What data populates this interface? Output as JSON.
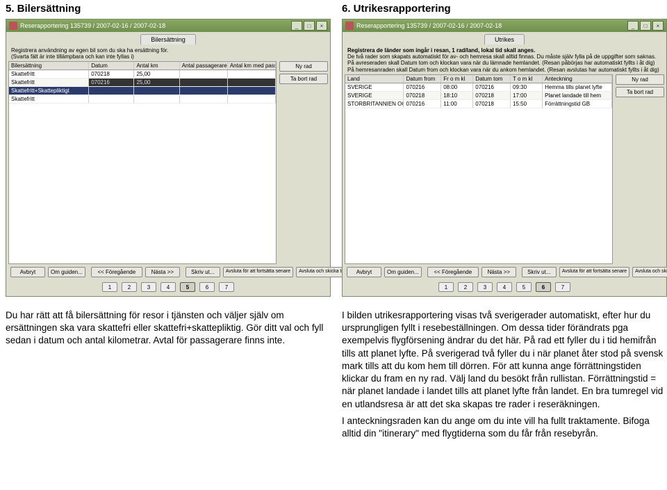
{
  "left": {
    "section_title": "5. Bilersättning",
    "window_title": "Reserapportering 135739 / 2007-02-16 / 2007-02-18",
    "tab_label": "Bilersättning",
    "instructions": [
      "Registrera användning av egen bil som du ska ha ersättning för.",
      "(Svarta fält är inte tillämpbara och kan inte fyllas i)"
    ],
    "columns": [
      "Bilersättning",
      "Datum",
      "Antal km",
      "Antal passagerare",
      "Antal km med passagerare"
    ],
    "rows": [
      {
        "cells": [
          "Skattefritt",
          "070218",
          "25,00",
          "",
          ""
        ],
        "sel": false
      },
      {
        "cells": [
          "Skattefritt",
          "070216",
          "25,00",
          "",
          ""
        ],
        "sel": false,
        "dark": true
      },
      {
        "cells": [
          "Skattefritt+Skattepliktigt",
          "",
          "",
          "",
          ""
        ],
        "sel": true
      },
      {
        "cells": [
          "Skattefritt",
          "",
          "",
          "",
          ""
        ],
        "sel": false
      }
    ],
    "side_buttons": {
      "new_row": "Ny rad",
      "delete_row": "Ta bort rad"
    },
    "footer": {
      "cancel": "Avbryt",
      "about": "Om guiden...",
      "prev": "<< Föregående",
      "next": "Nästa >>",
      "print": "Skriv ut...",
      "finish_later": "Avsluta för att fortsätta senare",
      "finish_send": "Avsluta och skicka till attest"
    },
    "steps": [
      "1",
      "2",
      "3",
      "4",
      "5",
      "6",
      "7"
    ],
    "active_step": 5,
    "description": "Du har rätt att få bilersättning för resor i tjänsten och väljer själv om ersättningen ska vara skattefri eller skattefri+skattepliktig. Gör ditt val och fyll sedan i datum och antal kilometrar. Avtal för passagerare finns inte."
  },
  "right": {
    "section_title": "6. Utrikesrapportering",
    "window_title": "Reserapportering 135739 / 2007-02-16 / 2007-02-18",
    "tab_label": "Utrikes",
    "instructions": [
      "Registrera de länder som ingår i resan, 1 rad/land, lokal tid skall anges.",
      "De två rader som skapats automatiskt för av- och hemresa skall alltid finnas. Du måste själv fylla på de uppgifter som saknas.",
      "På avreseraden skall Datum tom och klockan vara när du lämnade hemlandet. (Resan påbörjas har automatiskt fyllts i åt dig)",
      "På hemresanraden skall Datum from och klockan vara när du ankom hemlandet. (Resan avslutas har automatiskt fyllts i åt dig)"
    ],
    "columns": [
      "Land",
      "Datum from",
      "Fr o m kl",
      "Datum tom",
      "T o m kl",
      "Anteckning"
    ],
    "rows": [
      {
        "cells": [
          "SVERIGE",
          "070216",
          "08:00",
          "070216",
          "09:30",
          "Hemma tills planet lyfte"
        ]
      },
      {
        "cells": [
          "SVERIGE",
          "070218",
          "18:10",
          "070218",
          "17:00",
          "Planet landade till hem"
        ]
      },
      {
        "cells": [
          "STORBRITANNIEN OCH NO...",
          "070216",
          "11:00",
          "070218",
          "15:50",
          "Förrättningstid GB"
        ]
      }
    ],
    "side_buttons": {
      "new_row": "Ny rad",
      "delete_row": "Ta bort rad"
    },
    "footer": {
      "cancel": "Avbryt",
      "about": "Om guiden...",
      "prev": "<< Föregående",
      "next": "Nästa >>",
      "print": "Skriv ut...",
      "finish_later": "Avsluta för att fortsätta senare",
      "finish_send": "Avsluta och skicka till attest"
    },
    "steps": [
      "1",
      "2",
      "3",
      "4",
      "5",
      "6",
      "7"
    ],
    "active_step": 6,
    "description": "I bilden utrikesrapportering visas två sverigerader automatiskt, efter hur du ursprungligen fyllt i resebeställningen. Om dessa tider förändrats pga exempelvis flygförsening ändrar du det här. På rad ett fyller du i tid hemifrån tills att planet lyfte. På sverigerad två fyller du i när planet åter stod på svensk mark tills att du kom hem till dörren. För att kunna ange förrättningstiden klickar du fram en ny rad. Välj land du besökt från rullistan. Förrättningstid = när planet landade i landet tills att planet lyfte från landet. En bra tumregel vid en utlandsresa är att det ska skapas tre rader i reseräkningen.\nI anteckningsraden kan du ange om du inte vill ha fullt traktamente. Bifoga alltid din \"itinerary\" med flygtiderna som du får från resebyrån."
  },
  "winbtns": {
    "min": "_",
    "max": "□",
    "close": "×"
  }
}
